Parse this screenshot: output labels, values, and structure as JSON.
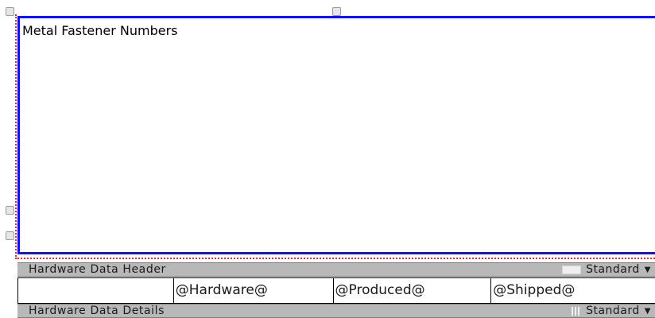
{
  "chart": {
    "title": "Metal Fastener Numbers"
  },
  "bands": {
    "header": {
      "label": "Hardware Data Header",
      "style": "Standard"
    },
    "details": {
      "label": "Hardware Data Details",
      "style": "Standard"
    }
  },
  "header_row": {
    "cells": [
      "",
      "@Hardware@",
      "@Produced@",
      "@Shipped@"
    ]
  },
  "colors": {
    "chart_border": "#1010ff",
    "guide": "#ff2020",
    "band_bg": "#b8b8b8"
  }
}
